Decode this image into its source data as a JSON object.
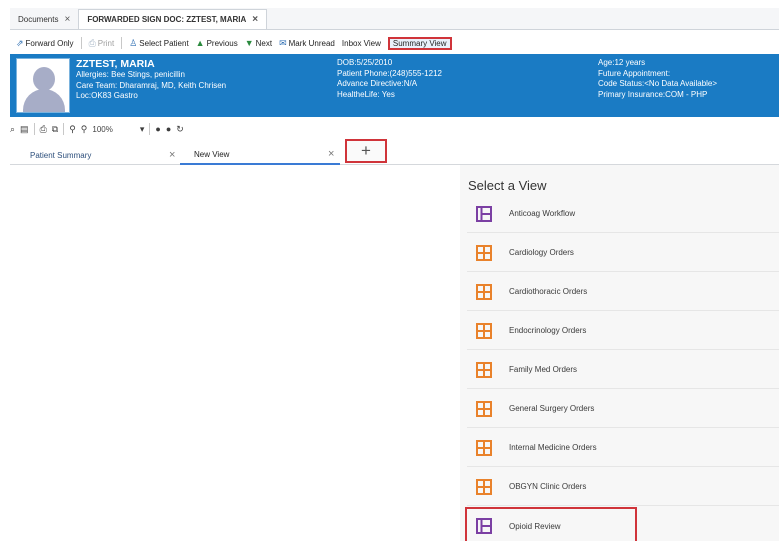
{
  "doc_tabs": [
    {
      "label": "Documents",
      "active": false
    },
    {
      "label": "FORWARDED SIGN DOC: ZZTEST, MARIA",
      "active": true
    }
  ],
  "toolbar": {
    "forward_only": "Forward Only",
    "print": "Print",
    "select_patient": "Select Patient",
    "previous": "Previous",
    "next": "Next",
    "mark_unread": "Mark Unread",
    "inbox_view": "Inbox View",
    "summary_view": "Summary View"
  },
  "banner": {
    "name": "ZZTEST, MARIA",
    "allergies": "Allergies: Bee Stings, penicillin",
    "care_team": "Care Team: Dharamraj, MD, Keith Chrisen",
    "loc": "Loc:OK83 Gastro",
    "dob": "DOB:5/25/2010",
    "phone": "Patient Phone:(248)555-1212",
    "advance_directive": "Advance Directive:N/A",
    "healthelife": "HealtheLife: Yes",
    "age": "Age:12 years",
    "future_appt": "Future Appointment:",
    "code_status": "Code Status:<No Data Available>",
    "insurance": "Primary Insurance:COM - PHP",
    "accent": "#1a7bc4"
  },
  "zoom": "100%",
  "view_tabs": {
    "patient_summary": "Patient Summary",
    "new_view": "New View",
    "add_symbol": "+"
  },
  "select_view": {
    "title": "Select a View",
    "items": [
      {
        "label": "Anticoag Workflow",
        "icon": "workflow-icon",
        "color": "#7b3fa3"
      },
      {
        "label": "Cardiology Orders",
        "icon": "orders-icon",
        "color": "#e9822b"
      },
      {
        "label": "Cardiothoracic Orders",
        "icon": "orders-icon",
        "color": "#e9822b"
      },
      {
        "label": "Endocrinology Orders",
        "icon": "orders-icon",
        "color": "#e9822b"
      },
      {
        "label": "Family Med Orders",
        "icon": "orders-icon",
        "color": "#e9822b"
      },
      {
        "label": "General Surgery Orders",
        "icon": "orders-icon",
        "color": "#e9822b"
      },
      {
        "label": "Internal Medicine Orders",
        "icon": "orders-icon",
        "color": "#e9822b"
      },
      {
        "label": "OBGYN Clinic Orders",
        "icon": "orders-icon",
        "color": "#e9822b"
      },
      {
        "label": "Opioid Review",
        "icon": "workflow-icon",
        "color": "#7b3fa3"
      }
    ]
  }
}
